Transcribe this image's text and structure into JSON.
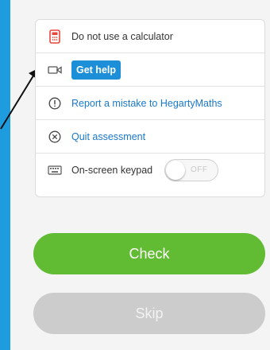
{
  "menu": {
    "calculator_note": "Do not use a calculator",
    "get_help": "Get help",
    "report_mistake": "Report a mistake to HegartyMaths",
    "quit": "Quit assessment",
    "keypad_label": "On-screen keypad",
    "keypad_state": "OFF"
  },
  "actions": {
    "check": "Check",
    "skip": "Skip"
  },
  "icons": {
    "calculator": "no-calculator-icon",
    "help": "video-camera-icon",
    "report": "exclamation-circle-icon",
    "quit": "x-circle-icon",
    "keypad": "keyboard-icon"
  },
  "colors": {
    "background_blue": "#1d9ce0",
    "help_button": "#1d8fd8",
    "link": "#1a78c8",
    "check_green": "#62bc33",
    "skip_grey": "#cccccc",
    "calculator_red": "#e8463b"
  }
}
